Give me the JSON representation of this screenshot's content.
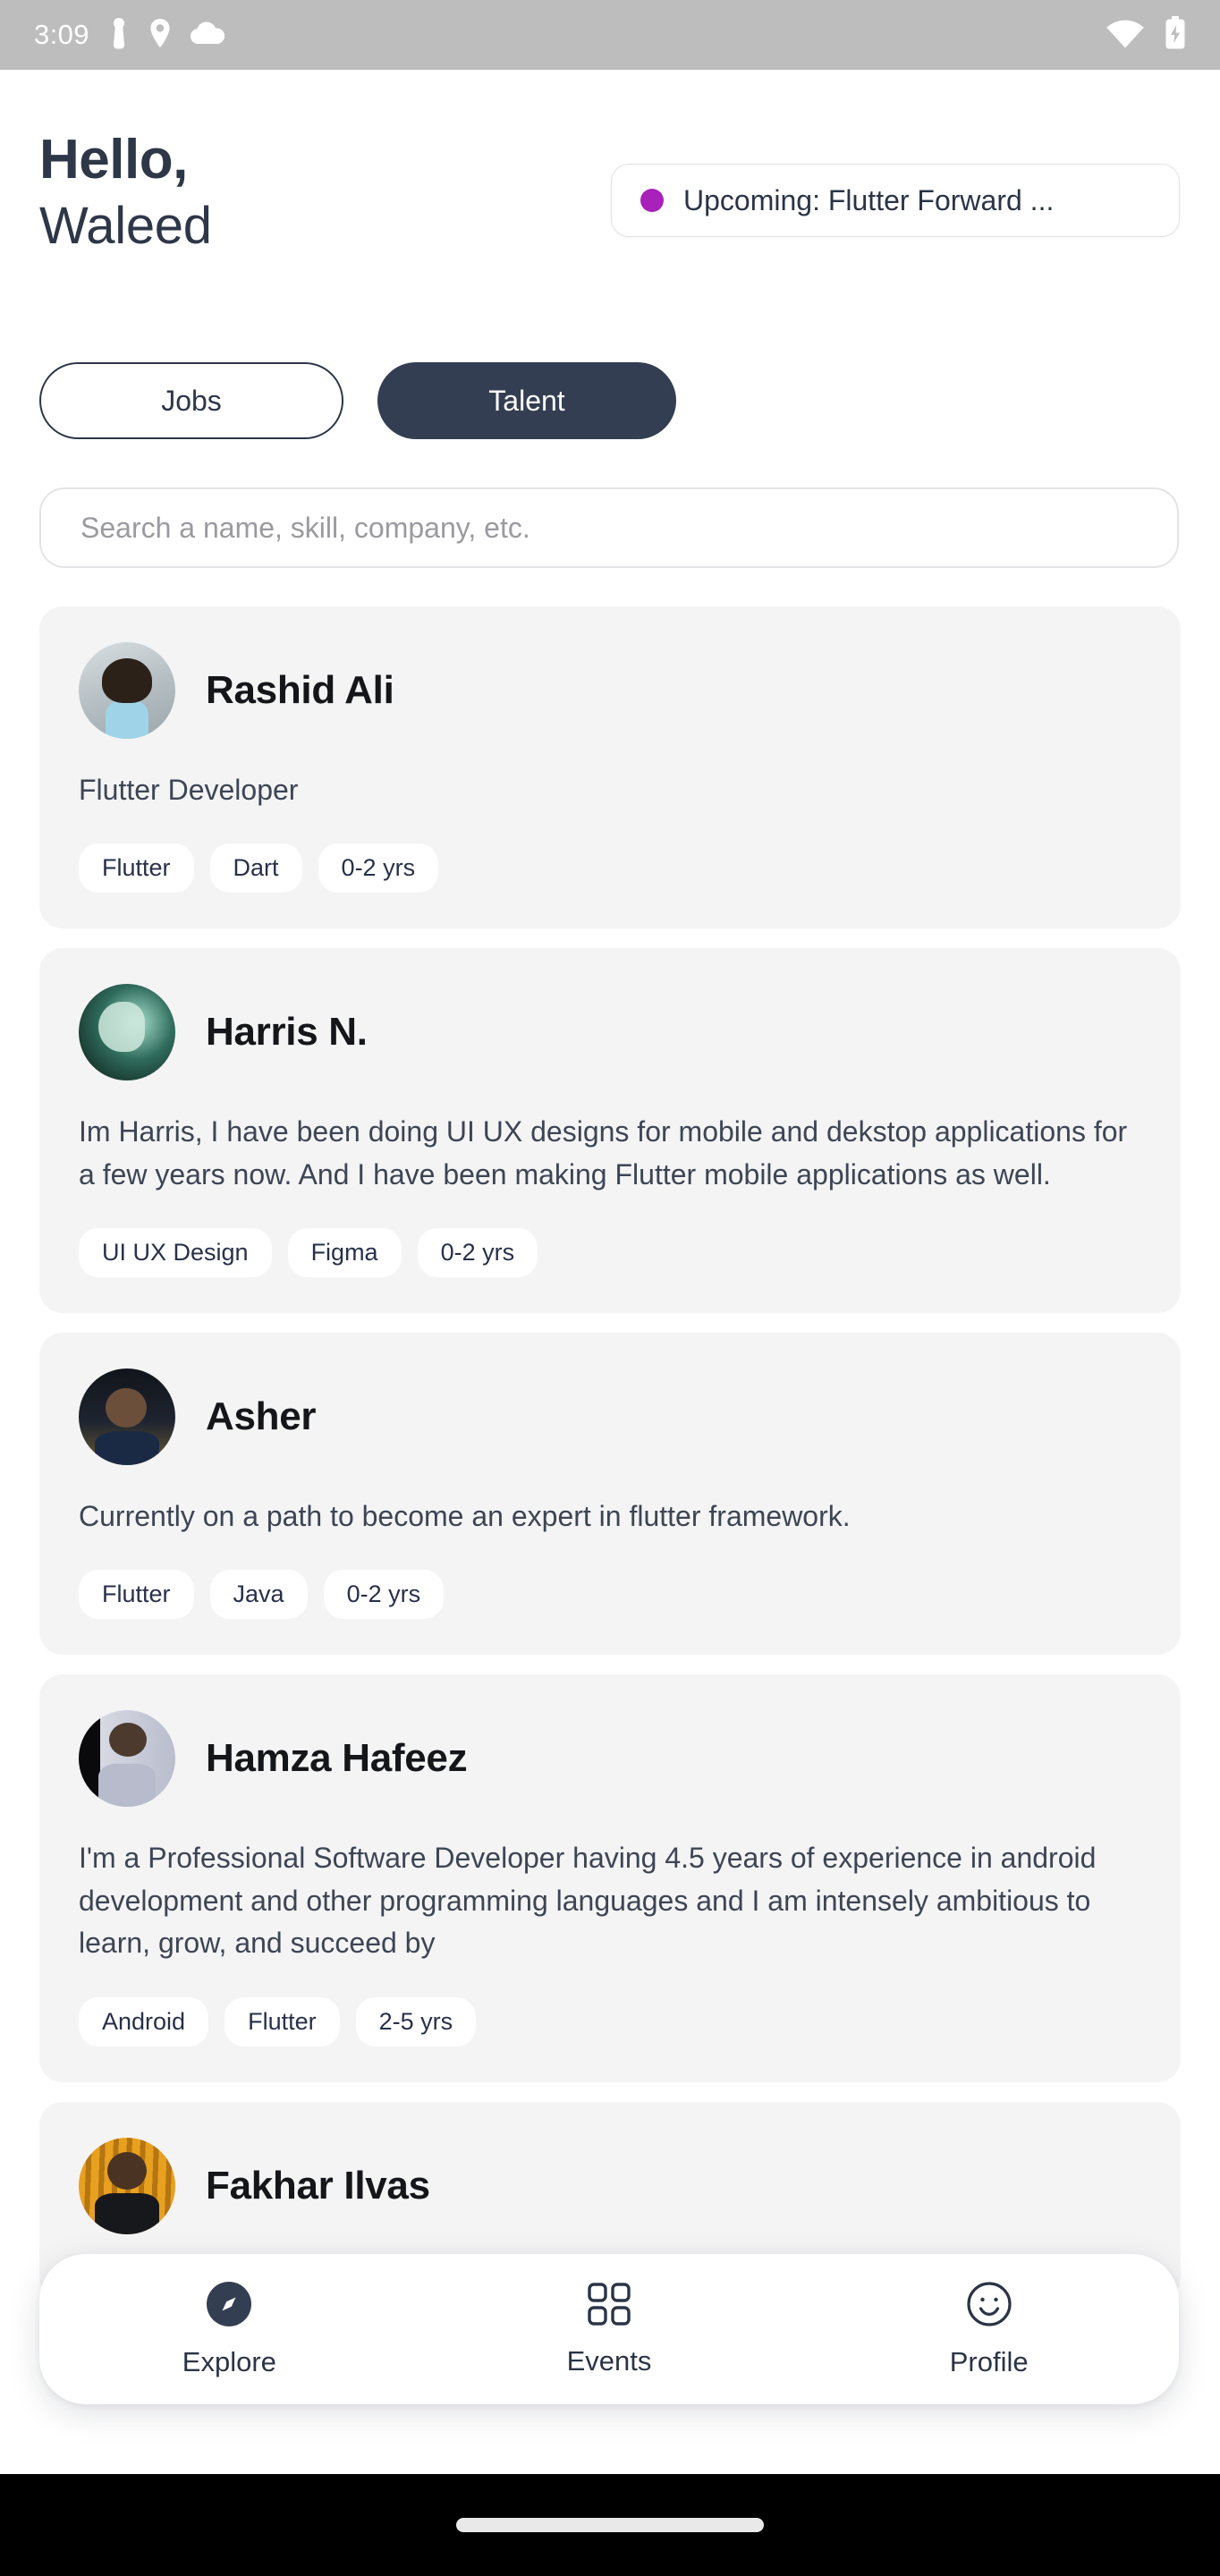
{
  "status_bar": {
    "time": "3:09",
    "left_icons": [
      "body-sensor-icon",
      "location-pin-icon",
      "cloud-icon"
    ],
    "right_icons": [
      "wifi-icon",
      "battery-charging-icon"
    ],
    "background_color": "#bdbdbd"
  },
  "header": {
    "greeting_line1": "Hello,",
    "greeting_line2": "Waleed",
    "upcoming": {
      "label": "Upcoming: Flutter Forward ...",
      "dot_color": "#a821ba"
    }
  },
  "tabs": {
    "items": [
      {
        "label": "Jobs",
        "active": false
      },
      {
        "label": "Talent",
        "active": true
      }
    ],
    "active_color": "#343e52"
  },
  "search": {
    "placeholder": "Search a name, skill, company, etc.",
    "value": ""
  },
  "talent_cards": [
    {
      "name": "Rashid Ali",
      "description": "Flutter Developer",
      "tags": [
        "Flutter",
        "Dart",
        "0-2 yrs"
      ],
      "avatar": "rashid-ali-avatar"
    },
    {
      "name": "Harris N.",
      "description": "Im Harris, I have been doing UI UX designs for mobile and dekstop applications for a few years now. And I have been making Flutter mobile applications as well.",
      "tags": [
        "UI UX Design",
        "Figma",
        "0-2 yrs"
      ],
      "avatar": "harris-n-avatar"
    },
    {
      "name": "Asher",
      "description": "Currently on a path to become an expert in flutter framework.",
      "tags": [
        "Flutter",
        "Java",
        "0-2 yrs"
      ],
      "avatar": "asher-avatar"
    },
    {
      "name": "Hamza Hafeez",
      "description": "I'm a Professional Software Developer having 4.5 years of experience in android development and other programming languages and I am intensely ambitious to learn, grow, and succeed by",
      "tags": [
        "Android",
        "Flutter",
        "2-5 yrs"
      ],
      "avatar": "hamza-hafeez-avatar"
    },
    {
      "name": "Fakhar Ilvas",
      "description": "",
      "tags": [],
      "avatar": "fakhar-ilvas-avatar"
    }
  ],
  "bottom_nav": {
    "items": [
      {
        "label": "Explore",
        "icon": "compass-icon",
        "active": true
      },
      {
        "label": "Events",
        "icon": "grid-icon",
        "active": false
      },
      {
        "label": "Profile",
        "icon": "smiley-face-icon",
        "active": false
      }
    ]
  },
  "colors": {
    "text_dark": "#2e3748",
    "card_bg": "#f4f4f5",
    "tag_bg": "#ffffff",
    "page_bg": "#ffffff"
  }
}
